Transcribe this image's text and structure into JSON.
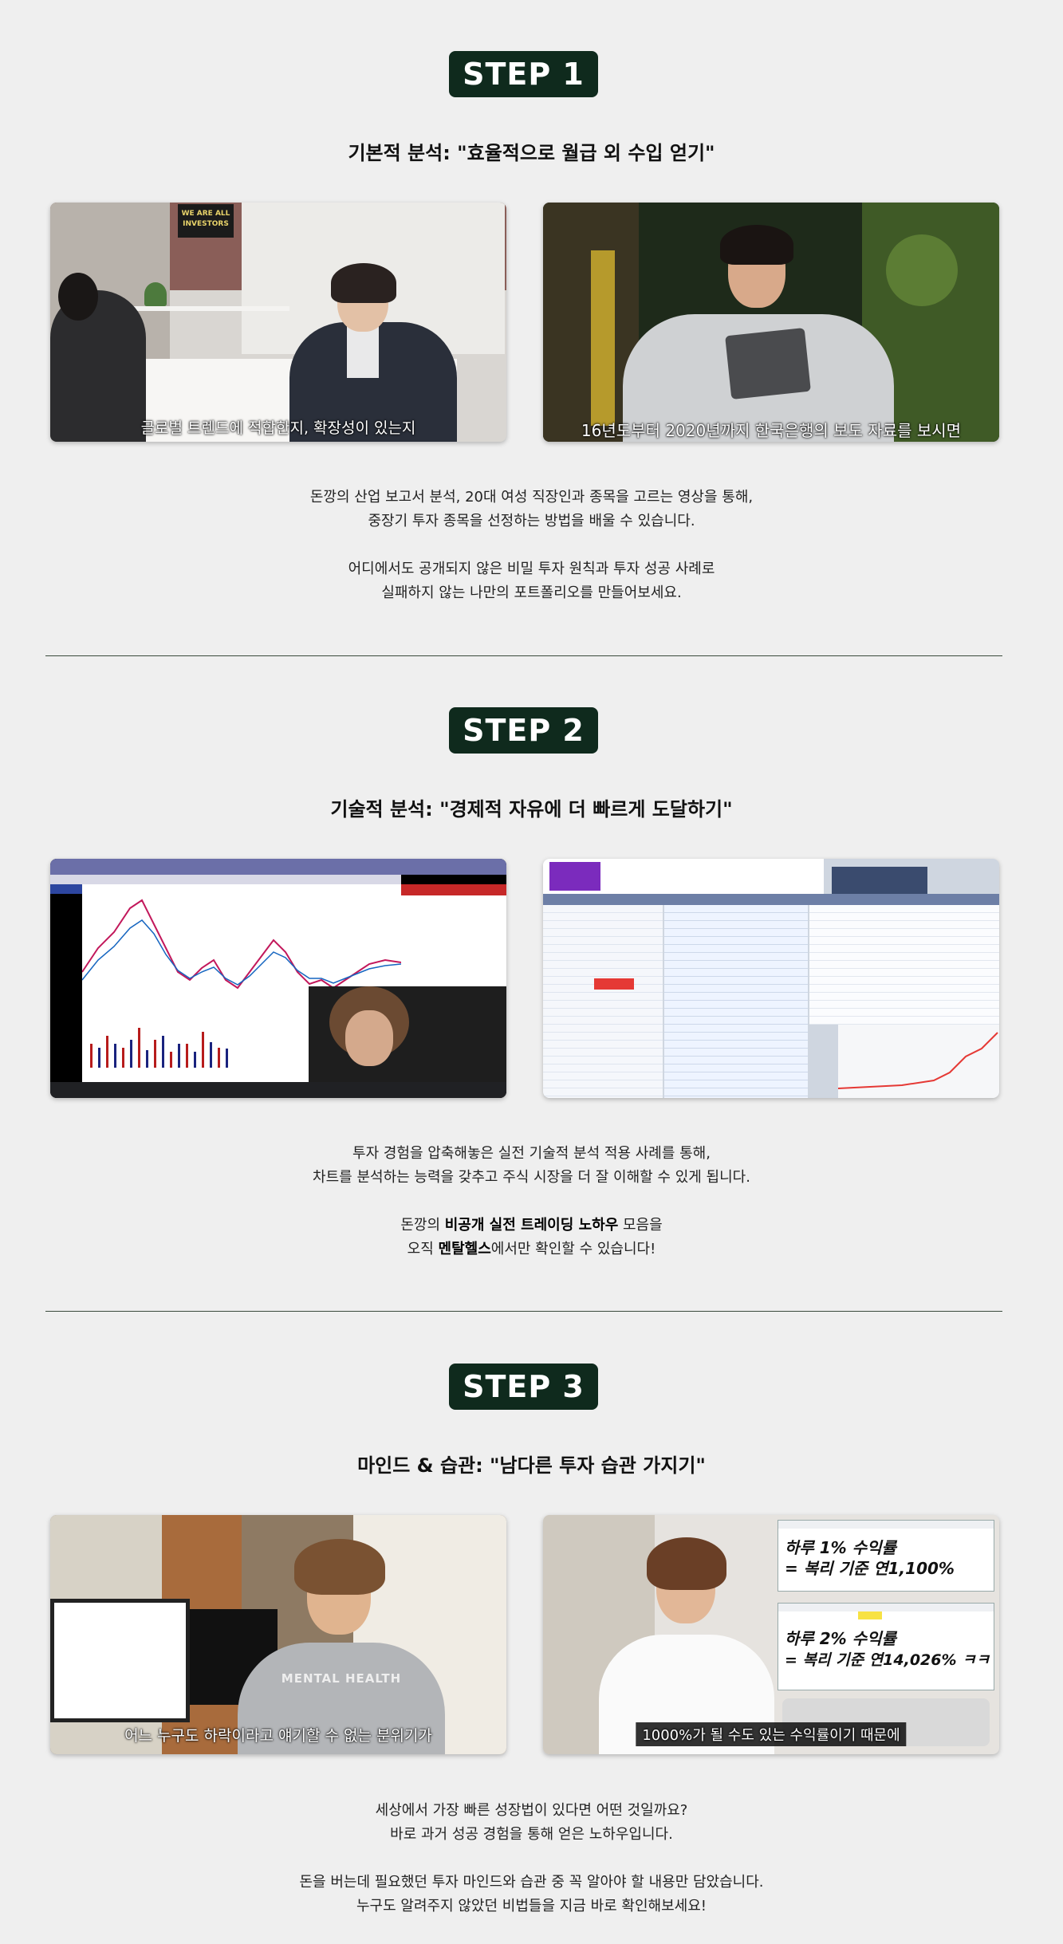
{
  "steps": [
    {
      "badge": "STEP 1",
      "heading": "기본적 분석: \"효율적으로 월급 외 수입 얻기\"",
      "left_caption": "글로벌 트렌드에 적합한지, 확장성이 있는지",
      "right_caption": "16년도부터 2020년까지 한국은행의 보도 자료를 보시면",
      "poster_text_1": "WE ARE ALL",
      "poster_text_2": "INVESTORS",
      "para1_line1": "돈깡의 산업 보고서 분석, 20대 여성 직장인과 종목을 고르는 영상을 통해,",
      "para1_line2": "중장기 투자 종목을 선정하는 방법을 배울 수 있습니다.",
      "para2_line1": "어디에서도 공개되지 않은 비밀 투자 원칙과 투자 성공 사례로",
      "para2_line2": "실패하지 않는 나만의 포트폴리오를 만들어보세요."
    },
    {
      "badge": "STEP 2",
      "heading": "기술적 분석: \"경제적 자유에 더 빠르게 도달하기\"",
      "para1_line1": "투자 경험을 압축해놓은 실전 기술적 분석 적용 사례를 통해,",
      "para1_line2": "차트를 분석하는 능력을 갖추고 주식 시장을 더 잘 이해할 수 있게 됩니다.",
      "para2_pre": "돈깡의 ",
      "para2_bold": "비공개 실전 트레이딩 노하우",
      "para2_post": " 모음을",
      "para3_pre": "오직 ",
      "para3_bold": "멘탈헬스",
      "para3_post": "에서만 확인할 수 있습니다!"
    },
    {
      "badge": "STEP 3",
      "heading": "마인드 & 습관: \"남다른 투자 습관 가지기\"",
      "left_caption": "어느 누구도 하락이라고 얘기할 수 없는 분위기가",
      "right_caption": "1000%가 될 수도 있는 수익률이기 때문에",
      "hoodie_text": "MENTAL HEALTH",
      "card1_line1": "하루 1% 수익률",
      "card1_line2": "= 복리 기준 연1,100%",
      "card2_line1": "하루 2% 수익률",
      "card2_line2": "= 복리 기준 연14,026% ㅋㅋ",
      "para1_line1": "세상에서 가장 빠른 성장법이 있다면 어떤 것일까요?",
      "para1_line2": "바로 과거 성공 경험을 통해 얻은 노하우입니다.",
      "para2_line1": "돈을 버는데 필요했던 투자 마인드와 습관 중 꼭 알아야 할 내용만 담았습니다.",
      "para2_line2": "누구도 알려주지 않았던 비법들을 지금 바로 확인해보세요!"
    }
  ],
  "colors": {
    "badge_bg": "#0f2a1d",
    "page_bg": "#efefef",
    "divider": "#3a4a3c"
  }
}
